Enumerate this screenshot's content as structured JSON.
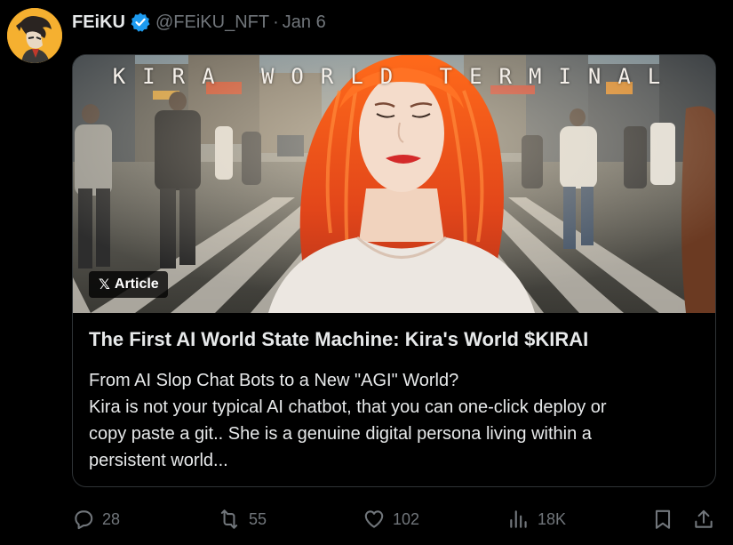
{
  "author": {
    "display_name": "FEiKU",
    "handle": "@FEiKU_NFT",
    "separator": "·",
    "date": "Jan 6"
  },
  "card": {
    "image_overlay_text": "KIRA WORLD TERMINAL",
    "badge_glyph": "𝕏",
    "badge_label": "Article",
    "title": "The First AI World State Machine: Kira's World $KIRAI",
    "description_lines": [
      "From AI Slop Chat Bots to a New \"AGI\" World?",
      "Kira is not your typical AI chatbot, that you can one-click deploy or",
      "copy paste a git.. She is a genuine digital persona living within a",
      "persistent world..."
    ]
  },
  "actions": {
    "replies": "28",
    "reposts": "55",
    "likes": "102",
    "views": "18K"
  },
  "colors": {
    "background": "#000000",
    "text_primary": "#e7e9ea",
    "text_secondary": "#71767b",
    "border": "#2f3336",
    "verified_blue": "#1d9bf0"
  }
}
